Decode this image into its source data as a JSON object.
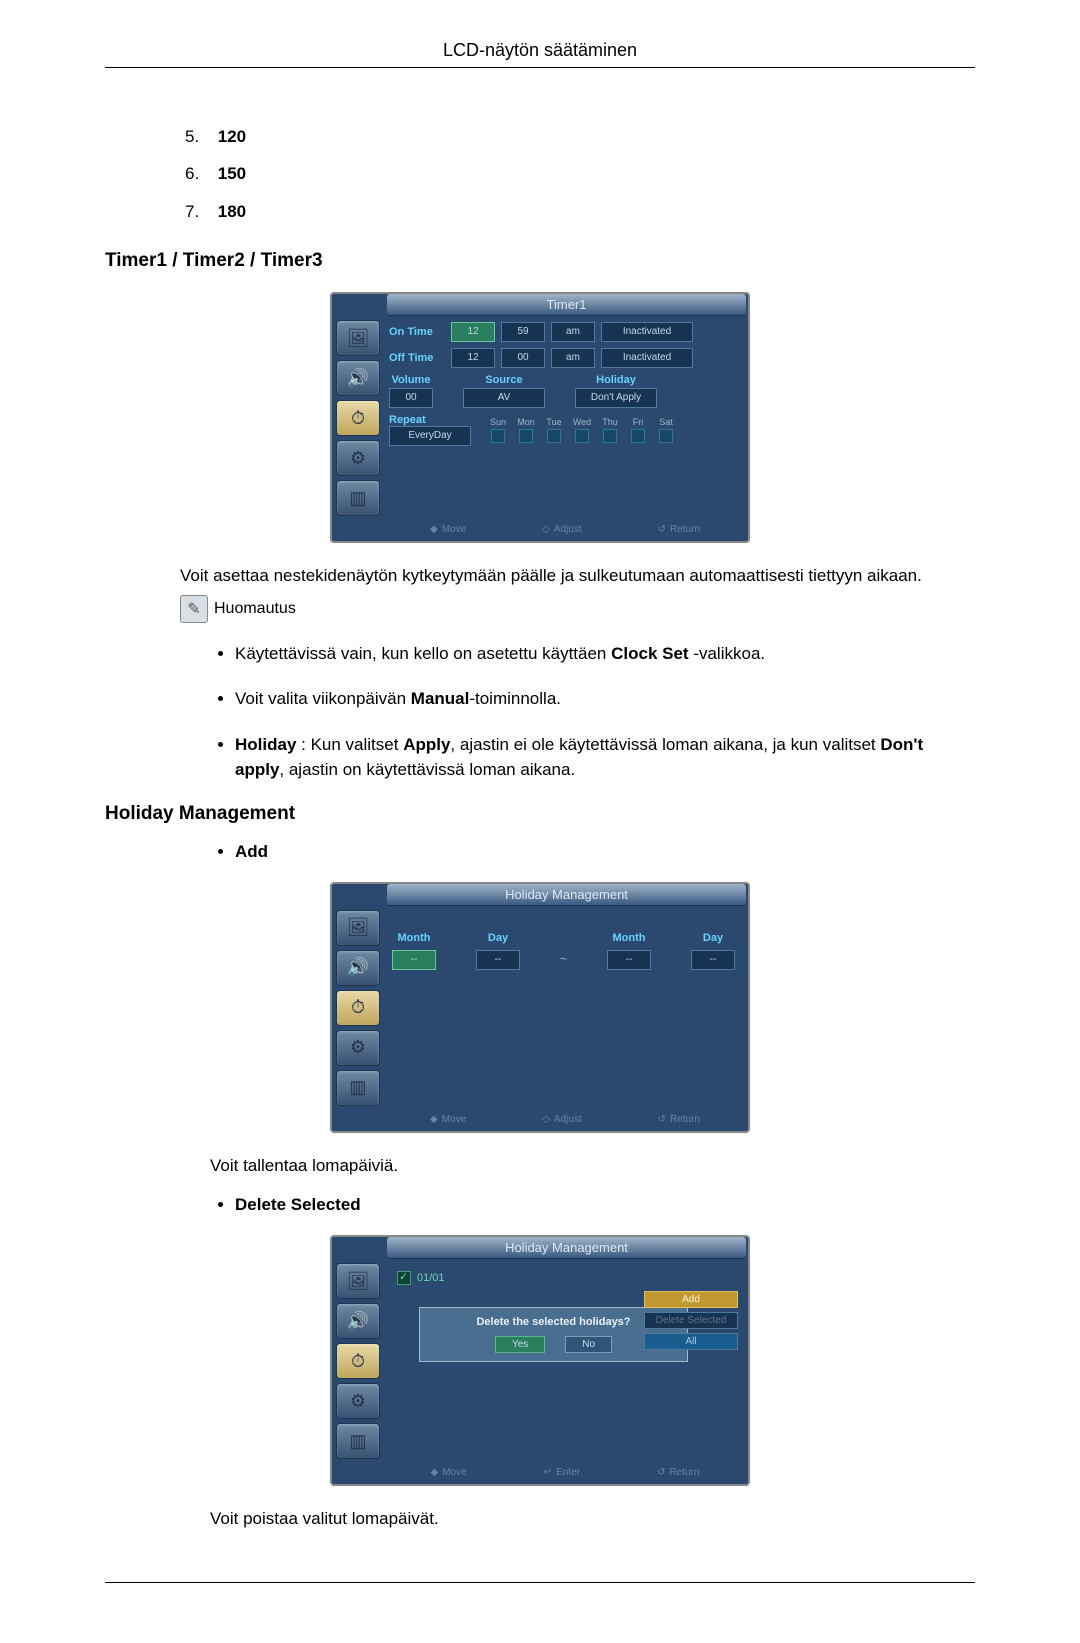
{
  "header": "LCD-näytön säätäminen",
  "numbered": [
    {
      "n": "5.",
      "v": "120"
    },
    {
      "n": "6.",
      "v": "150"
    },
    {
      "n": "7.",
      "v": "180"
    }
  ],
  "timer_heading": "Timer1 / Timer2 / Timer3",
  "timer_osd": {
    "title": "Timer1",
    "ontime_label": "On Time",
    "ontime_h": "12",
    "ontime_m": "59",
    "ontime_ampm": "am",
    "ontime_state": "Inactivated",
    "offtime_label": "Off Time",
    "offtime_h": "12",
    "offtime_m": "00",
    "offtime_ampm": "am",
    "offtime_state": "Inactivated",
    "volume_label": "Volume",
    "volume_val": "00",
    "source_label": "Source",
    "source_val": "AV",
    "holiday_label": "Holiday",
    "holiday_val": "Don't Apply",
    "repeat_label": "Repeat",
    "repeat_val": "EveryDay",
    "days": [
      "Sun",
      "Mon",
      "Tue",
      "Wed",
      "Thu",
      "Fri",
      "Sat"
    ],
    "footer_move": "Move",
    "footer_adjust": "Adjust",
    "footer_return": "Return"
  },
  "timer_desc": "Voit asettaa nestekidenäytön kytkeytymään päälle ja sulkeutumaan automaattisesti tiettyyn aikaan.",
  "note_label": "Huomautus",
  "notes": {
    "b1_pre": "Käytettävissä vain, kun kello on asetettu käyttäen ",
    "b1_bold": "Clock Set",
    "b1_post": " -valikkoa.",
    "b2_pre": "Voit valita viikonpäivän ",
    "b2_bold": "Manual",
    "b2_post": "-toiminnolla.",
    "b3_bold1": "Holiday",
    "b3_mid1": " : Kun valitset ",
    "b3_bold2": "Apply",
    "b3_mid2": ", ajastin ei ole käytettävissä loman aikana, ja kun valitset ",
    "b3_bold3": "Don't apply",
    "b3_post": ", ajastin on käytettävissä loman aikana."
  },
  "hm_heading": "Holiday Management",
  "hm_add_label": "Add",
  "hm_osd1": {
    "title": "Holiday Management",
    "month_label": "Month",
    "day_label": "Day",
    "val": "--",
    "footer_move": "Move",
    "footer_adjust": "Adjust",
    "footer_return": "Return"
  },
  "hm_add_desc": "Voit tallentaa lomapäiviä.",
  "hm_del_label": "Delete Selected",
  "hm_osd2": {
    "title": "Holiday Management",
    "entry": "01/01",
    "add_btn": "Add",
    "del_btn": "Delete Selected",
    "all_btn": "All",
    "dialog_text": "Delete the selected holidays?",
    "yes": "Yes",
    "no": "No",
    "footer_move": "Move",
    "footer_enter": "Enter",
    "footer_return": "Return"
  },
  "hm_del_desc": "Voit poistaa valitut lomapäivät."
}
